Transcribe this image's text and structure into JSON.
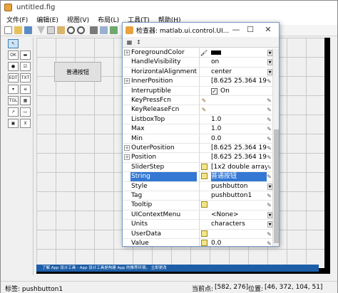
{
  "window": {
    "title": "untitled.fig"
  },
  "menu": [
    "文件(F)",
    "编辑(E)",
    "视图(V)",
    "布局(L)",
    "工具(T)",
    "帮助(H)"
  ],
  "canvas": {
    "pushbutton_label": "普通按钮"
  },
  "appbar": {
    "text": "了解 App 设计工具 - App 设计工具是构建 App 的推荐环境。 立即更改"
  },
  "status": {
    "tag_label": "标签: pushbutton1",
    "current_point_label": "当前点:",
    "current_point_value": "[582, 276]",
    "position_label": "位置:",
    "position_value": "[46, 372, 104, 51]"
  },
  "inspector": {
    "title": "检查器: matlab.ui.control.UI...",
    "rows": [
      {
        "name": "ForegroundColor",
        "expand": "+",
        "value": "",
        "editor": "paint",
        "swatch": "#000000",
        "dropdown": true
      },
      {
        "name": "HandleVisibility",
        "value": "on",
        "dropdown": true
      },
      {
        "name": "HorizontalAlignment",
        "value": "center",
        "dropdown": true
      },
      {
        "name": "InnerPosition",
        "expand": "+",
        "value": "[8.625 25.364 19.62...",
        "pen": true
      },
      {
        "name": "Interruptible",
        "value": "On",
        "checkbox": true
      },
      {
        "name": "KeyPressFcn",
        "value": "",
        "editor": "wand",
        "pen": true
      },
      {
        "name": "KeyReleaseFcn",
        "value": "",
        "editor": "wand",
        "pen": true
      },
      {
        "name": "ListboxTop",
        "value": "1.0",
        "pen": true
      },
      {
        "name": "Max",
        "value": "1.0",
        "pen": true
      },
      {
        "name": "Min",
        "value": "0.0",
        "pen": true
      },
      {
        "name": "OuterPosition",
        "expand": "+",
        "value": "[8.625 25.364 19.62...",
        "pen": true
      },
      {
        "name": "Position",
        "expand": "+",
        "value": "[8.625 25.364 19.62...",
        "pen": true
      },
      {
        "name": "SliderStep",
        "value": "[1x2  double array]",
        "editor": "grid",
        "pen": true
      },
      {
        "name": "String",
        "value": "普通按钮",
        "editor": "grid",
        "pen": true,
        "selected": true
      },
      {
        "name": "Style",
        "value": "pushbutton",
        "dropdown": true
      },
      {
        "name": "Tag",
        "value": "pushbutton1",
        "pen": true
      },
      {
        "name": "Tooltip",
        "value": "",
        "editor": "grid",
        "pen": true
      },
      {
        "name": "UIContextMenu",
        "value": "<None>",
        "dropdown": true
      },
      {
        "name": "Units",
        "value": "characters",
        "dropdown": true
      },
      {
        "name": "UserData",
        "value": "",
        "editor": "grid",
        "pen": true
      },
      {
        "name": "Value",
        "value": "0.0",
        "editor": "grid",
        "pen": true
      }
    ]
  },
  "colors": {
    "selection": "#3478d4",
    "appbar": "#1d5ea8"
  }
}
